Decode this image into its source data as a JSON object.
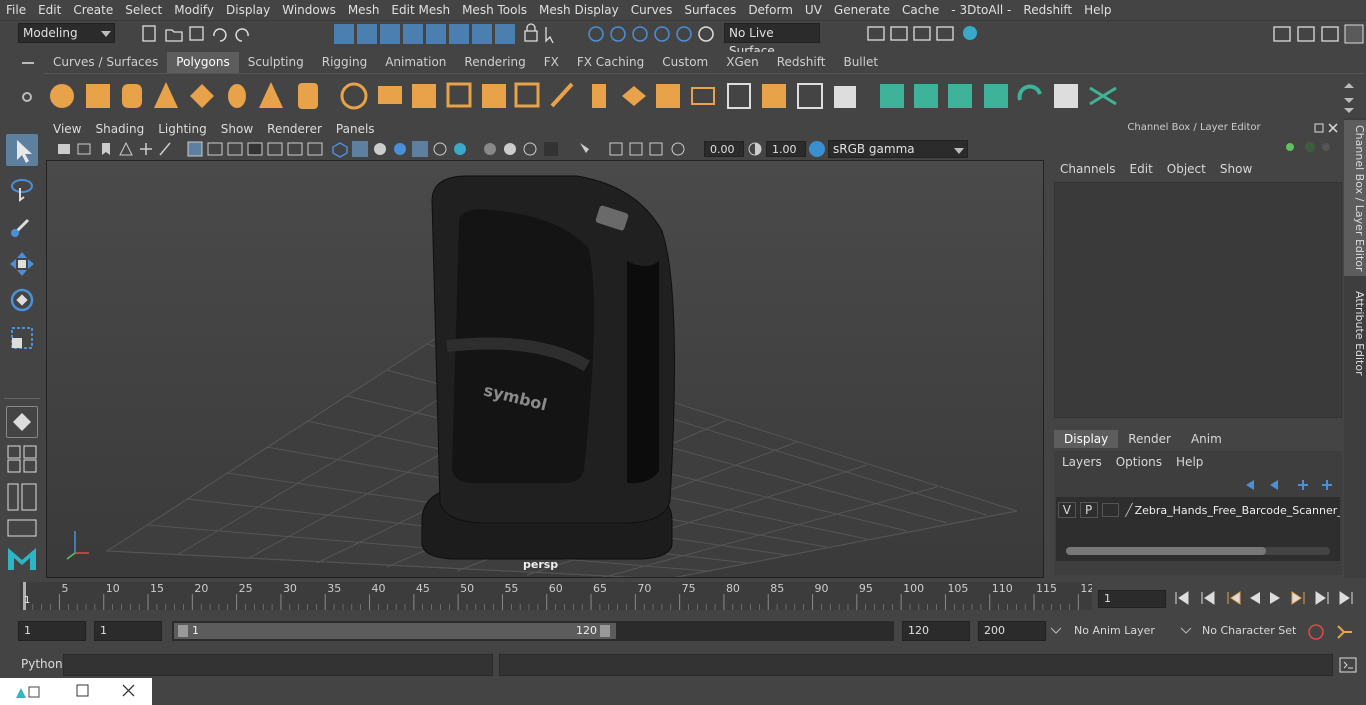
{
  "menubar": [
    "File",
    "Edit",
    "Create",
    "Select",
    "Modify",
    "Display",
    "Windows",
    "Mesh",
    "Edit Mesh",
    "Mesh Tools",
    "Mesh Display",
    "Curves",
    "Surfaces",
    "Deform",
    "UV",
    "Generate",
    "Cache",
    "- 3DtoAll -",
    "Redshift",
    "Help"
  ],
  "statusline": {
    "mode": "Modeling",
    "live_surface": "No Live Surface"
  },
  "shelf": {
    "tabs": [
      "Curves / Surfaces",
      "Polygons",
      "Sculpting",
      "Rigging",
      "Animation",
      "Rendering",
      "FX",
      "FX Caching",
      "Custom",
      "XGen",
      "Redshift",
      "Bullet"
    ],
    "active_tab": "Polygons"
  },
  "viewport": {
    "menu": [
      "View",
      "Shading",
      "Lighting",
      "Show",
      "Renderer",
      "Panels"
    ],
    "exposure": "0.00",
    "gamma": "1.00",
    "color_space": "sRGB gamma",
    "camera_label": "persp",
    "model_brand": "symbol"
  },
  "channel_box": {
    "title": "Channel Box / Layer Editor",
    "menu": [
      "Channels",
      "Edit",
      "Object",
      "Show"
    ]
  },
  "layer_editor": {
    "tabs": [
      "Display",
      "Render",
      "Anim"
    ],
    "active_tab": "Display",
    "menu": [
      "Layers",
      "Options",
      "Help"
    ],
    "layer": {
      "v": "V",
      "p": "P",
      "name": "Zebra_Hands_Free_Barcode_Scanner_"
    }
  },
  "side_tabs": [
    "Channel Box / Layer Editor",
    "Attribute Editor"
  ],
  "timeline": {
    "ticks": [
      "5",
      "10",
      "15",
      "20",
      "25",
      "30",
      "35",
      "40",
      "45",
      "50",
      "55",
      "60",
      "65",
      "70",
      "75",
      "80",
      "85",
      "90",
      "95",
      "100",
      "105",
      "110",
      "115",
      "12"
    ],
    "start_marker": "1",
    "current_frame": "1"
  },
  "range": {
    "start": "1",
    "playback_start": "1",
    "slider_start": "1",
    "slider_end": "120",
    "playback_end": "120",
    "end": "200",
    "anim_layer": "No Anim Layer",
    "character_set": "No Character Set"
  },
  "cmdline": {
    "label": "Python"
  },
  "colors": {
    "accent": "#5d5d5d",
    "icon_orange": "#e8a24a",
    "icon_teal": "#3fb39a",
    "icon_blue": "#4a8fd8"
  }
}
